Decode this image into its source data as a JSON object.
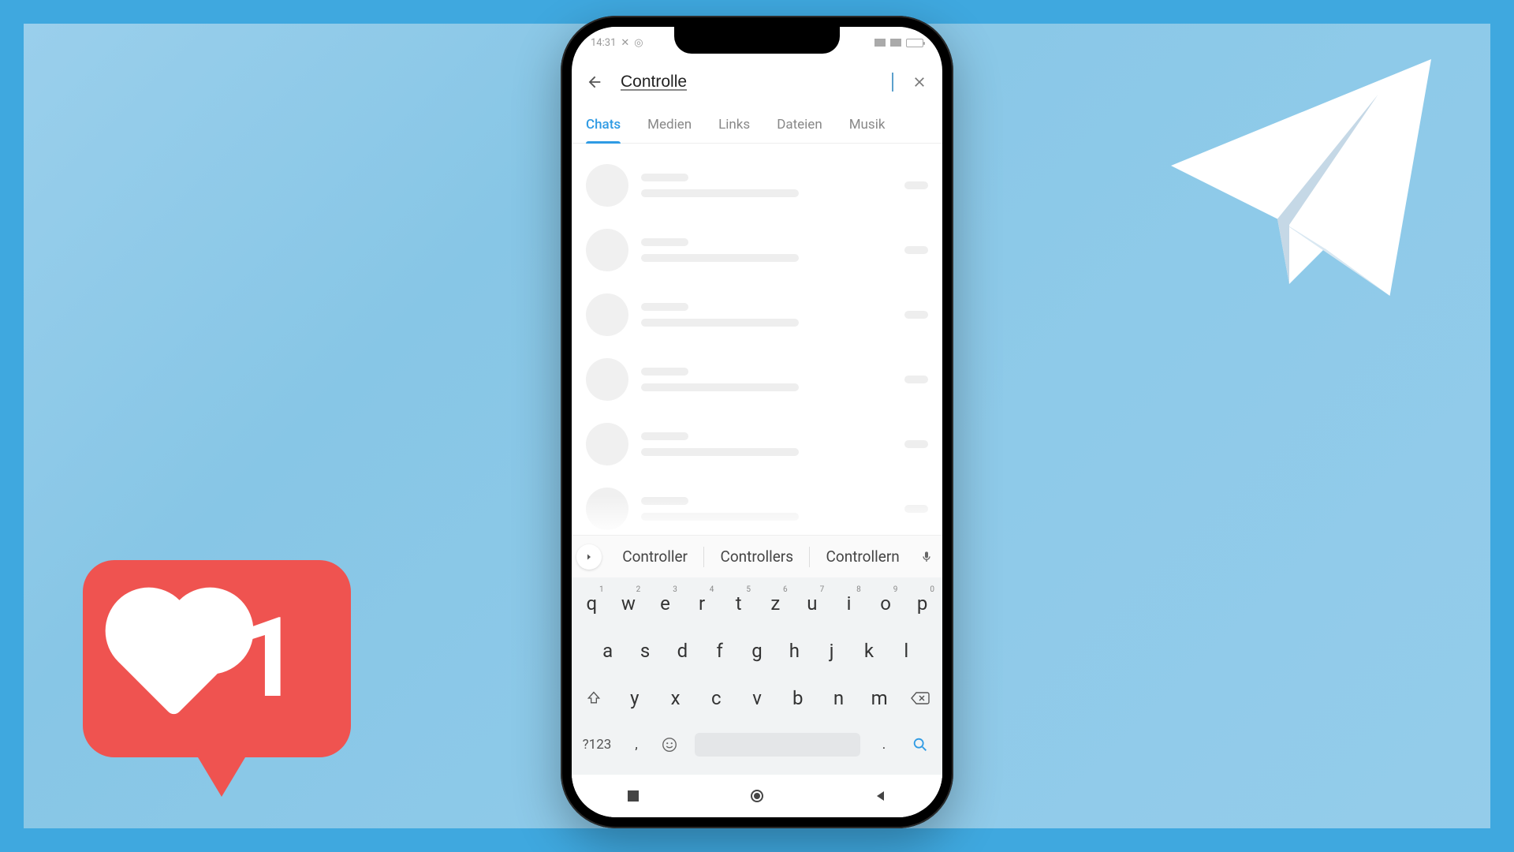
{
  "status": {
    "time": "14:31"
  },
  "search": {
    "value": "Controlle"
  },
  "tabs": [
    "Chats",
    "Medien",
    "Links",
    "Dateien",
    "Musik"
  ],
  "active_tab": "Chats",
  "suggestions": [
    "Controller",
    "Controllers",
    "Controllern"
  ],
  "keyboard": {
    "row1": [
      {
        "k": "q",
        "n": "1"
      },
      {
        "k": "w",
        "n": "2"
      },
      {
        "k": "e",
        "n": "3"
      },
      {
        "k": "r",
        "n": "4"
      },
      {
        "k": "t",
        "n": "5"
      },
      {
        "k": "z",
        "n": "6"
      },
      {
        "k": "u",
        "n": "7"
      },
      {
        "k": "i",
        "n": "8"
      },
      {
        "k": "o",
        "n": "9"
      },
      {
        "k": "p",
        "n": "0"
      }
    ],
    "row2": [
      "a",
      "s",
      "d",
      "f",
      "g",
      "h",
      "j",
      "k",
      "l"
    ],
    "row3": [
      "y",
      "x",
      "c",
      "v",
      "b",
      "n",
      "m"
    ],
    "sym_label": "?123",
    "comma": ",",
    "period": "."
  },
  "like": {
    "count": "1"
  },
  "colors": {
    "accent": "#2f9be4",
    "like_bg": "#ef5350",
    "bg": "#3fa8df"
  }
}
